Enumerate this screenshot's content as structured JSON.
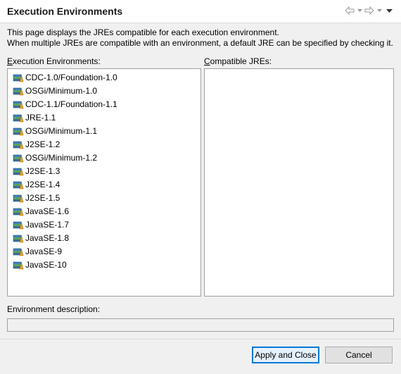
{
  "header": {
    "title": "Execution Environments",
    "icons": [
      "back-arrow-icon",
      "back-dropdown-icon",
      "forward-arrow-icon",
      "forward-dropdown-icon",
      "view-menu-icon"
    ]
  },
  "description": {
    "line1": "This page displays the JREs compatible for each execution environment.",
    "line2": "When multiple JREs are compatible with an environment, a default JRE can be specified by checking it."
  },
  "environments": {
    "label_mnemonic": "E",
    "label_rest": "xecution Environments:",
    "items": [
      "CDC-1.0/Foundation-1.0",
      "OSGi/Minimum-1.0",
      "CDC-1.1/Foundation-1.1",
      "JRE-1.1",
      "OSGi/Minimum-1.1",
      "J2SE-1.2",
      "OSGi/Minimum-1.2",
      "J2SE-1.3",
      "J2SE-1.4",
      "J2SE-1.5",
      "JavaSE-1.6",
      "JavaSE-1.7",
      "JavaSE-1.8",
      "JavaSE-9",
      "JavaSE-10"
    ],
    "item_icon": "library-icon"
  },
  "compatible": {
    "label_mnemonic": "C",
    "label_rest": "ompatible JREs:",
    "items": []
  },
  "environment_description": {
    "label": "Environment description:",
    "value": ""
  },
  "buttons": {
    "apply_close": "Apply and Close",
    "cancel": "Cancel"
  },
  "colors": {
    "background": "#f0f0f0",
    "focus_border": "#0078d7"
  }
}
